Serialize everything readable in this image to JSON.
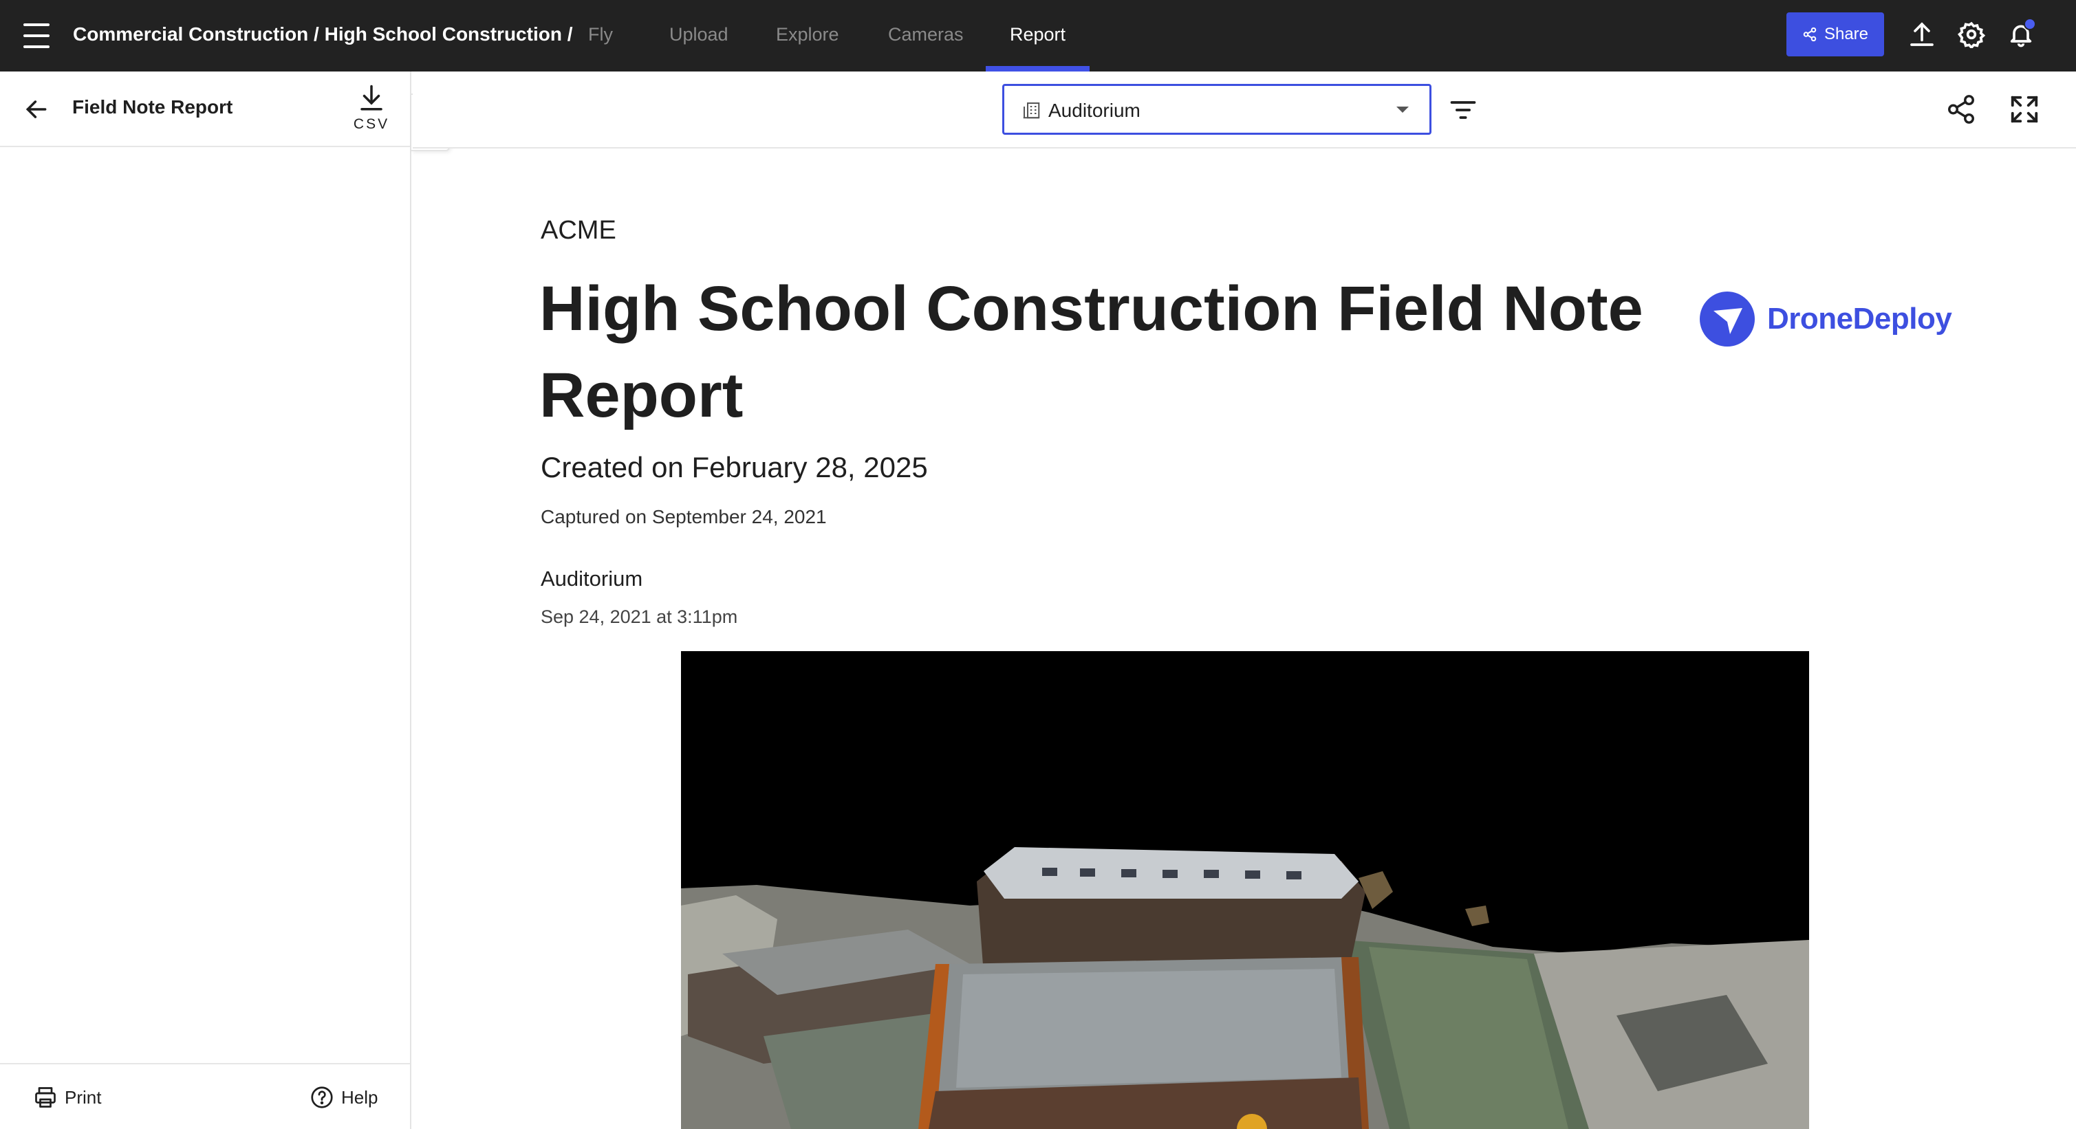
{
  "topnav": {
    "breadcrumb": "Commercial Construction / High School Construction /",
    "tabs": [
      {
        "label": "Fly",
        "active": false
      },
      {
        "label": "Upload",
        "active": false
      },
      {
        "label": "Explore",
        "active": false
      },
      {
        "label": "Cameras",
        "active": false
      },
      {
        "label": "Report",
        "active": true
      }
    ],
    "share_label": "Share",
    "accent": "#3d4fe0"
  },
  "left_panel": {
    "title": "Field Note Report",
    "csv_label": "CSV",
    "print_label": "Print",
    "help_label": "Help"
  },
  "header": {
    "location_value": "Auditorium"
  },
  "report": {
    "company": "ACME",
    "title": "High School Construction Field Note Report",
    "logo_text": "DroneDeploy",
    "created": "Created on February 28, 2025",
    "captured": "Captured on September 24, 2021",
    "note": {
      "title": "Auditorium",
      "date": "Sep 24, 2021 at 3:11pm"
    }
  }
}
